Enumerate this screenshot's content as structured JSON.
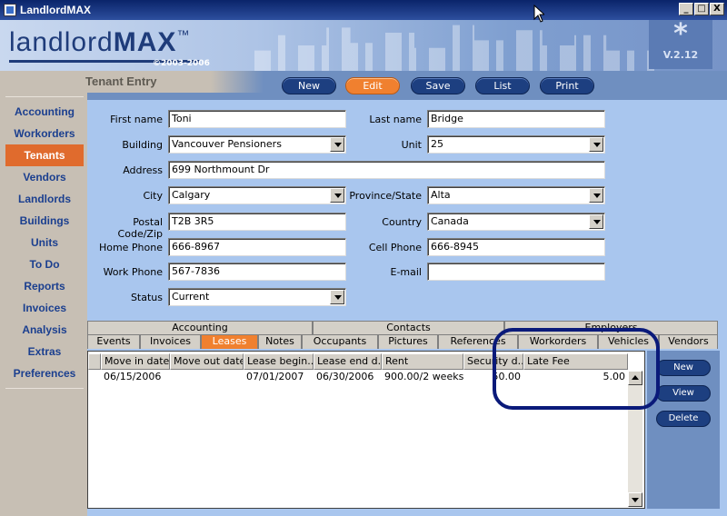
{
  "window": {
    "title": "LandlordMAX",
    "controls": {
      "minimize": "_",
      "maximize": "□",
      "close": "X"
    }
  },
  "header": {
    "logo_prefix": "landlord",
    "logo_suffix": "MAX",
    "trademark": "™",
    "copyright": "©2003-2006",
    "version": "V.2.12",
    "version_glyph": "*"
  },
  "section": {
    "title": "Tenant Entry"
  },
  "toolbar": {
    "new_label": "New",
    "edit_label": "Edit",
    "save_label": "Save",
    "list_label": "List",
    "print_label": "Print"
  },
  "sidebar": {
    "items": [
      {
        "label": "Accounting"
      },
      {
        "label": "Workorders"
      },
      {
        "label": "Tenants",
        "active": true
      },
      {
        "label": "Vendors"
      },
      {
        "label": "Landlords"
      },
      {
        "label": "Buildings"
      },
      {
        "label": "Units"
      },
      {
        "label": "To Do"
      },
      {
        "label": "Reports"
      },
      {
        "label": "Invoices"
      },
      {
        "label": "Analysis"
      },
      {
        "label": "Extras"
      },
      {
        "label": "Preferences"
      }
    ]
  },
  "form": {
    "first_name": {
      "label": "First name",
      "value": "Toni"
    },
    "last_name": {
      "label": "Last name",
      "value": "Bridge"
    },
    "building": {
      "label": "Building",
      "value": "Vancouver Pensioners"
    },
    "unit": {
      "label": "Unit",
      "value": "25"
    },
    "address": {
      "label": "Address",
      "value": "699 Northmount Dr"
    },
    "city": {
      "label": "City",
      "value": "Calgary"
    },
    "province": {
      "label": "Province/State",
      "value": "Alta"
    },
    "postal": {
      "label": "Postal Code/Zip",
      "value": "T2B 3R5"
    },
    "country": {
      "label": "Country",
      "value": "Canada"
    },
    "home_phone": {
      "label": "Home Phone",
      "value": "666-8967"
    },
    "cell_phone": {
      "label": "Cell Phone",
      "value": "666-8945"
    },
    "work_phone": {
      "label": "Work Phone",
      "value": "567-7836"
    },
    "email": {
      "label": "E-mail",
      "value": ""
    },
    "status": {
      "label": "Status",
      "value": "Current"
    }
  },
  "tabs": {
    "top_row": [
      "Accounting",
      "Contacts",
      "Employers"
    ],
    "bottom_row": [
      "Events",
      "Invoices",
      "Leases",
      "Notes",
      "Occupants",
      "Pictures",
      "References",
      "Workorders",
      "Vehicles",
      "Vendors"
    ],
    "active": "Leases"
  },
  "leases_table": {
    "columns": [
      "Move in date",
      "Move out date",
      "Lease begin...",
      "Lease end d...",
      "Rent",
      "Security d...",
      "Late Fee"
    ],
    "rows": [
      [
        "06/15/2006",
        "",
        "07/01/2007",
        "06/30/2006",
        "900.00/2 weeks",
        "50.00",
        "5.00"
      ]
    ]
  },
  "lease_actions": {
    "new_label": "New",
    "view_label": "View",
    "delete_label": "Delete"
  },
  "colors": {
    "accent_orange": "#f0802f",
    "nav_blue": "#1b3f8f",
    "panel_blue": "#a9c6ee",
    "highlight_ring": "#0a1a7a"
  }
}
